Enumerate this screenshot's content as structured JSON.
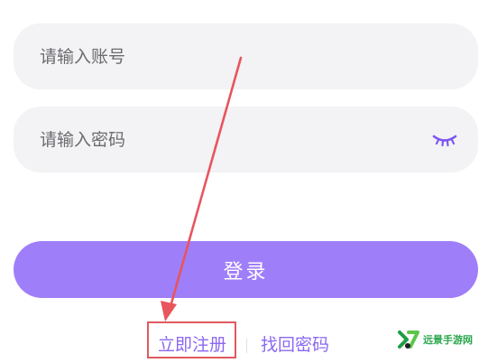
{
  "login_form": {
    "account": {
      "placeholder": "请输入账号",
      "value": ""
    },
    "password": {
      "placeholder": "请输入密码",
      "value": "",
      "toggle_icon": "eye-closed-icon",
      "toggle_color": "#7c57f0"
    },
    "login_label": "登录",
    "register_label": "立即注册",
    "forgot_label": "找回密码"
  },
  "colors": {
    "accent": "#9f7ef9",
    "link": "#8b68f0",
    "field_background": "#f3f2f4",
    "annotation_red": "#e15a5f"
  },
  "watermark": {
    "text": "远景手游网",
    "icon": "watermark-logo-icon"
  }
}
